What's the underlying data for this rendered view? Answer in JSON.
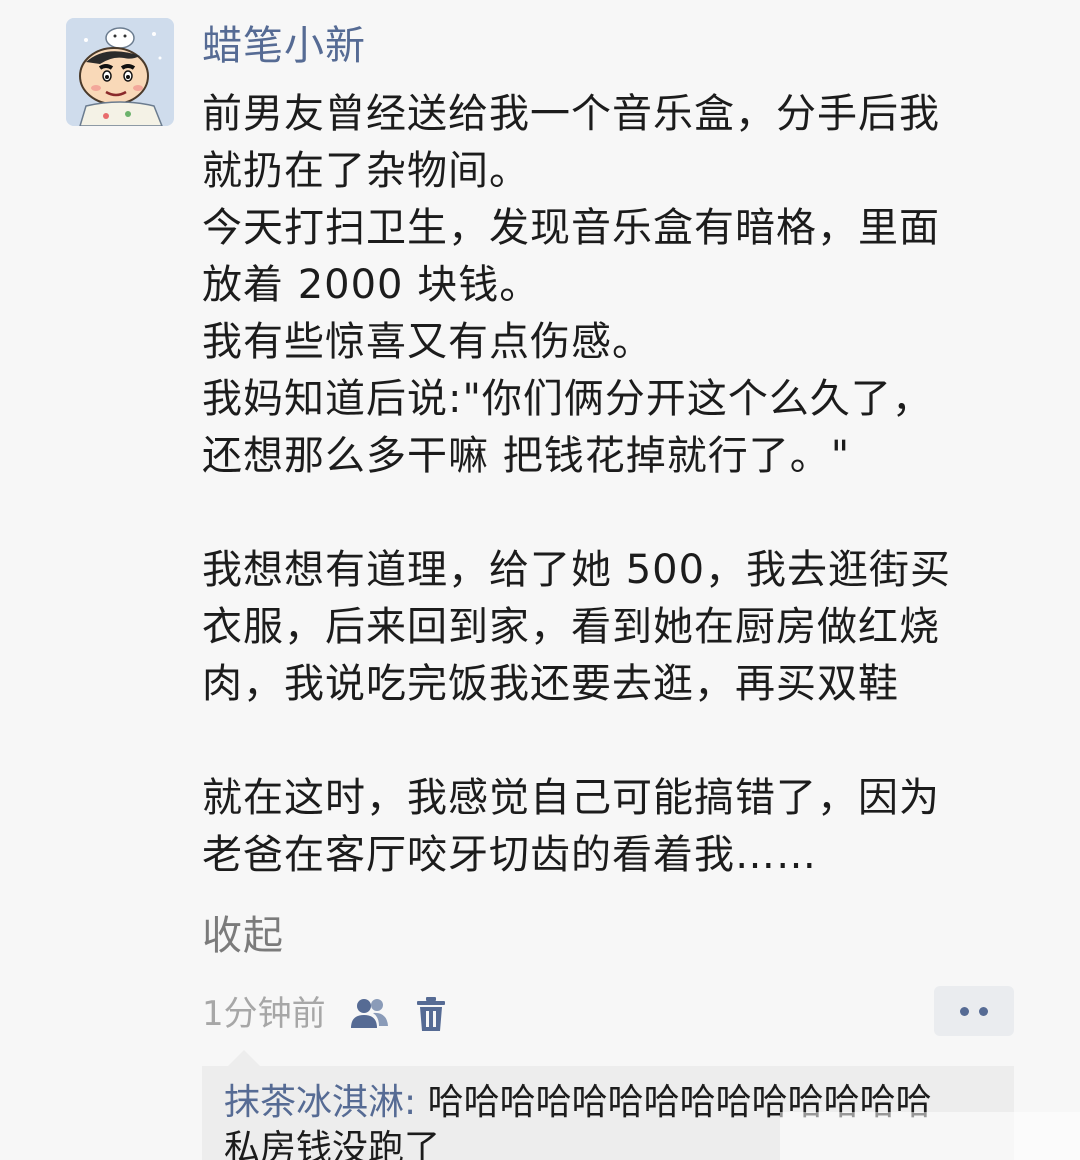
{
  "post": {
    "username": "蜡笔小新",
    "avatar_icon": "crayon-shinchan-avatar",
    "paragraphs": [
      "前男友曾经送给我一个音乐盒，分手后我\n就扔在了杂物间。",
      "今天打扫卫生，发现音乐盒有暗格，里面\n放着 2000 块钱。",
      "我有些惊喜又有点伤感。",
      "我妈知道后说:\"你们俩分开这个么久了，\n还想那么多干嘛 把钱花掉就行了。\"",
      "",
      "我想想有道理，给了她 500，我去逛街买\n衣服，后来回到家，看到她在厨房做红烧\n肉，我说吃完饭我还要去逛，再买双鞋",
      "",
      "就在这时，我感觉自己可能搞错了，因为\n老爸在客厅咬牙切齿的看着我……"
    ],
    "collapse_label": "收起",
    "time": "1分钟前",
    "friends_icon": "friends-visibility-icon",
    "delete_icon": "trash-icon",
    "more_icon": "more-dots-icon"
  },
  "comment": {
    "author": "抹茶冰淇淋:",
    "text": " 哈哈哈哈哈哈哈哈哈哈哈哈哈哈\n私房钱没跑了"
  },
  "colors": {
    "username": "#566b94",
    "background": "#f7f7f7",
    "comment_bg": "#ededed",
    "secondary_text": "#a7a7a7"
  }
}
